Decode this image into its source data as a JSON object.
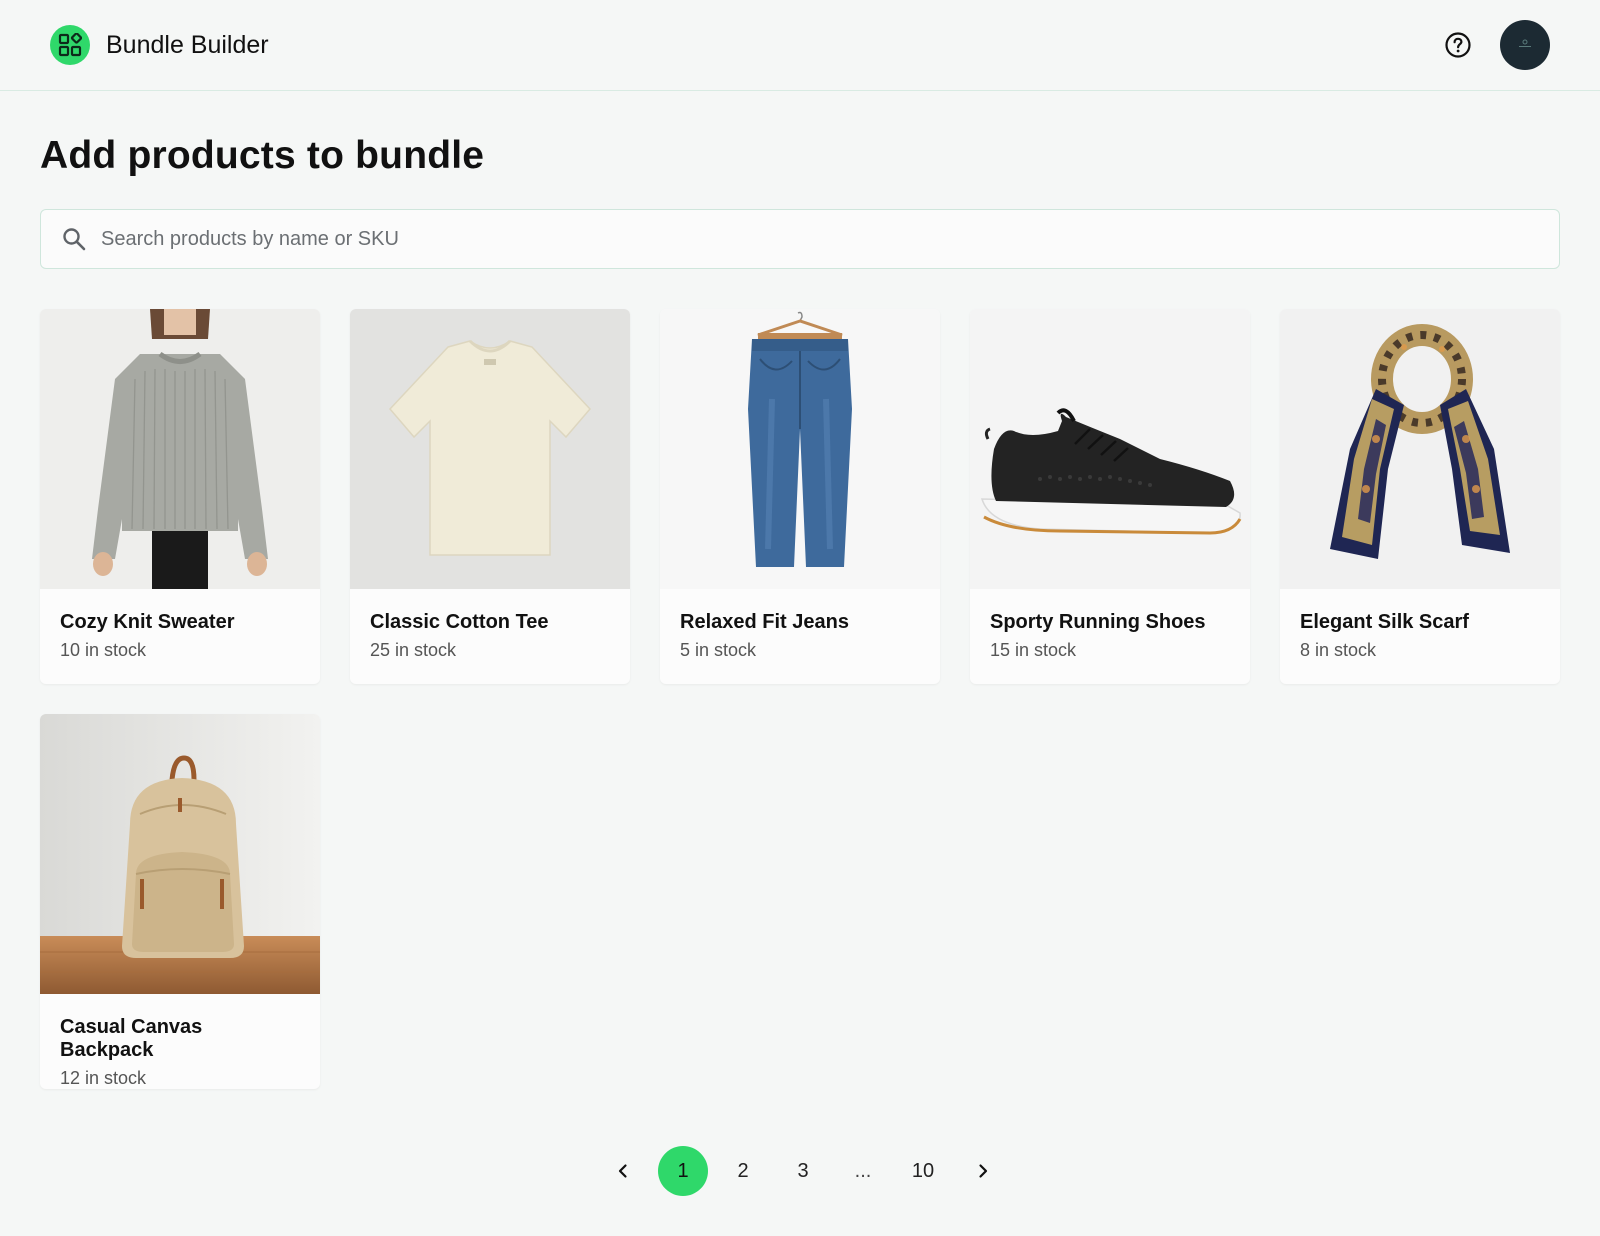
{
  "header": {
    "title": "Bundle Builder",
    "logo_icon": "bundle-grid-icon",
    "help_icon": "help-circle-icon",
    "avatar_icon": "avatar"
  },
  "main": {
    "title": "Add products to bundle",
    "search": {
      "placeholder": "Search products by name or SKU",
      "value": ""
    }
  },
  "products": [
    {
      "name": "Cozy Knit Sweater",
      "stock": "10 in stock",
      "image": "sweater"
    },
    {
      "name": "Classic Cotton Tee",
      "stock": "25 in stock",
      "image": "tee"
    },
    {
      "name": "Relaxed Fit Jeans",
      "stock": "5 in stock",
      "image": "jeans"
    },
    {
      "name": "Sporty Running Shoes",
      "stock": "15 in stock",
      "image": "shoes"
    },
    {
      "name": "Elegant Silk Scarf",
      "stock": "8 in stock",
      "image": "scarf"
    },
    {
      "name": "Casual Canvas Backpack",
      "stock": "12 in stock",
      "image": "backpack"
    }
  ],
  "pagination": {
    "pages": [
      "1",
      "2",
      "3",
      "...",
      "10"
    ],
    "active": "1",
    "prev_icon": "chevron-left-icon",
    "next_icon": "chevron-right-icon"
  },
  "colors": {
    "accent": "#2fd86a",
    "background": "#f5f7f6",
    "card": "#fcfcfc",
    "avatar": "#1c2a33"
  }
}
